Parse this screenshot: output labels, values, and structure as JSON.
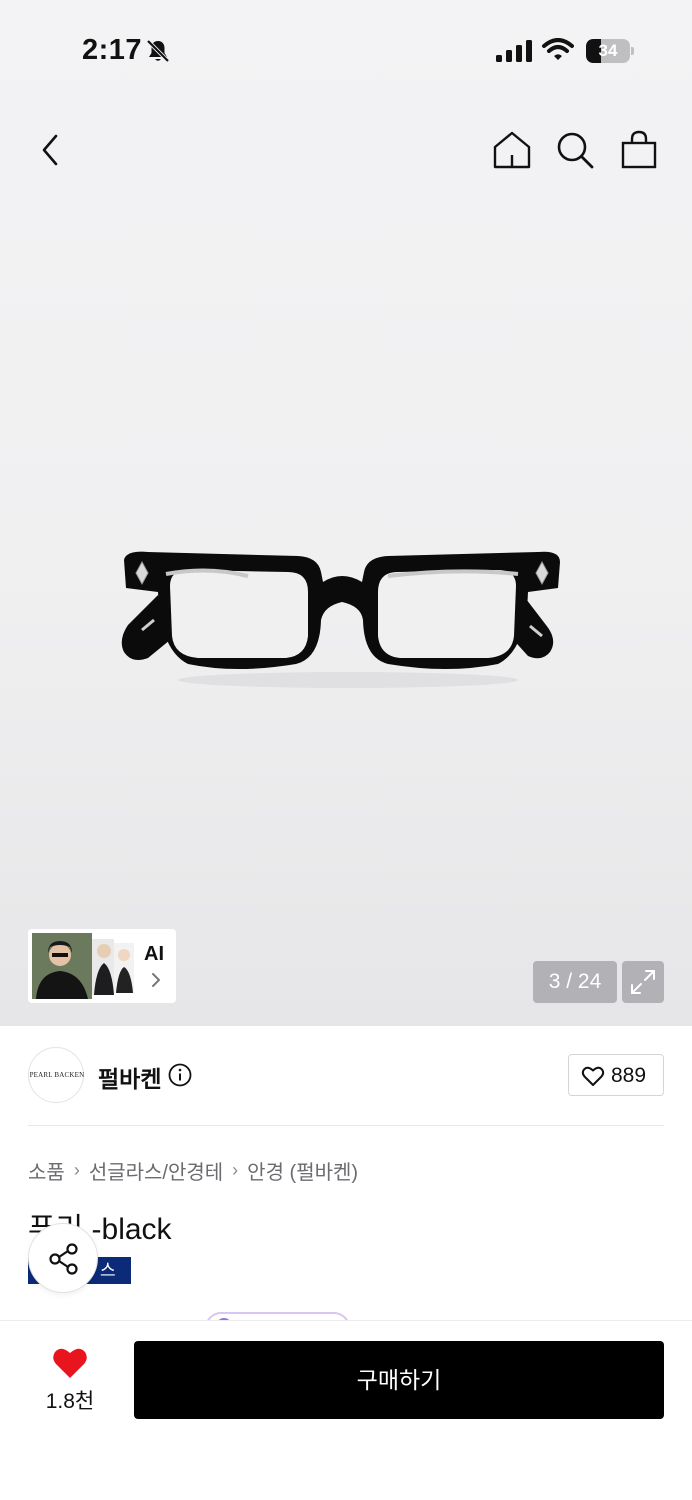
{
  "status_bar": {
    "time": "2:17",
    "battery_percent": "34",
    "battery_level": 0.34,
    "icons": [
      "bell-off-icon",
      "signal-icon",
      "wifi-icon",
      "battery-icon"
    ]
  },
  "nav": {
    "icons": [
      "back-chevron-icon",
      "home-icon",
      "search-icon",
      "shopping-bag-icon"
    ]
  },
  "gallery": {
    "ai_label": "AI",
    "counter": "3 / 24",
    "current_index": 3,
    "total": 24
  },
  "brand": {
    "logo_text": "PEARL BACKEN",
    "name": "펄바켄",
    "like_count": "889"
  },
  "breadcrumb": [
    "소품",
    "선글라스/안경테",
    "안경 (펄바켄)"
  ],
  "product": {
    "title": "푸리 -black",
    "badge": "스타"
  },
  "bottom_bar": {
    "wish_count": "1.8천",
    "buy_label": "구매하기"
  },
  "colors": {
    "accent_heart": "#e8141e",
    "buy_button": "#000000",
    "badge_bg": "#0b2a78"
  }
}
